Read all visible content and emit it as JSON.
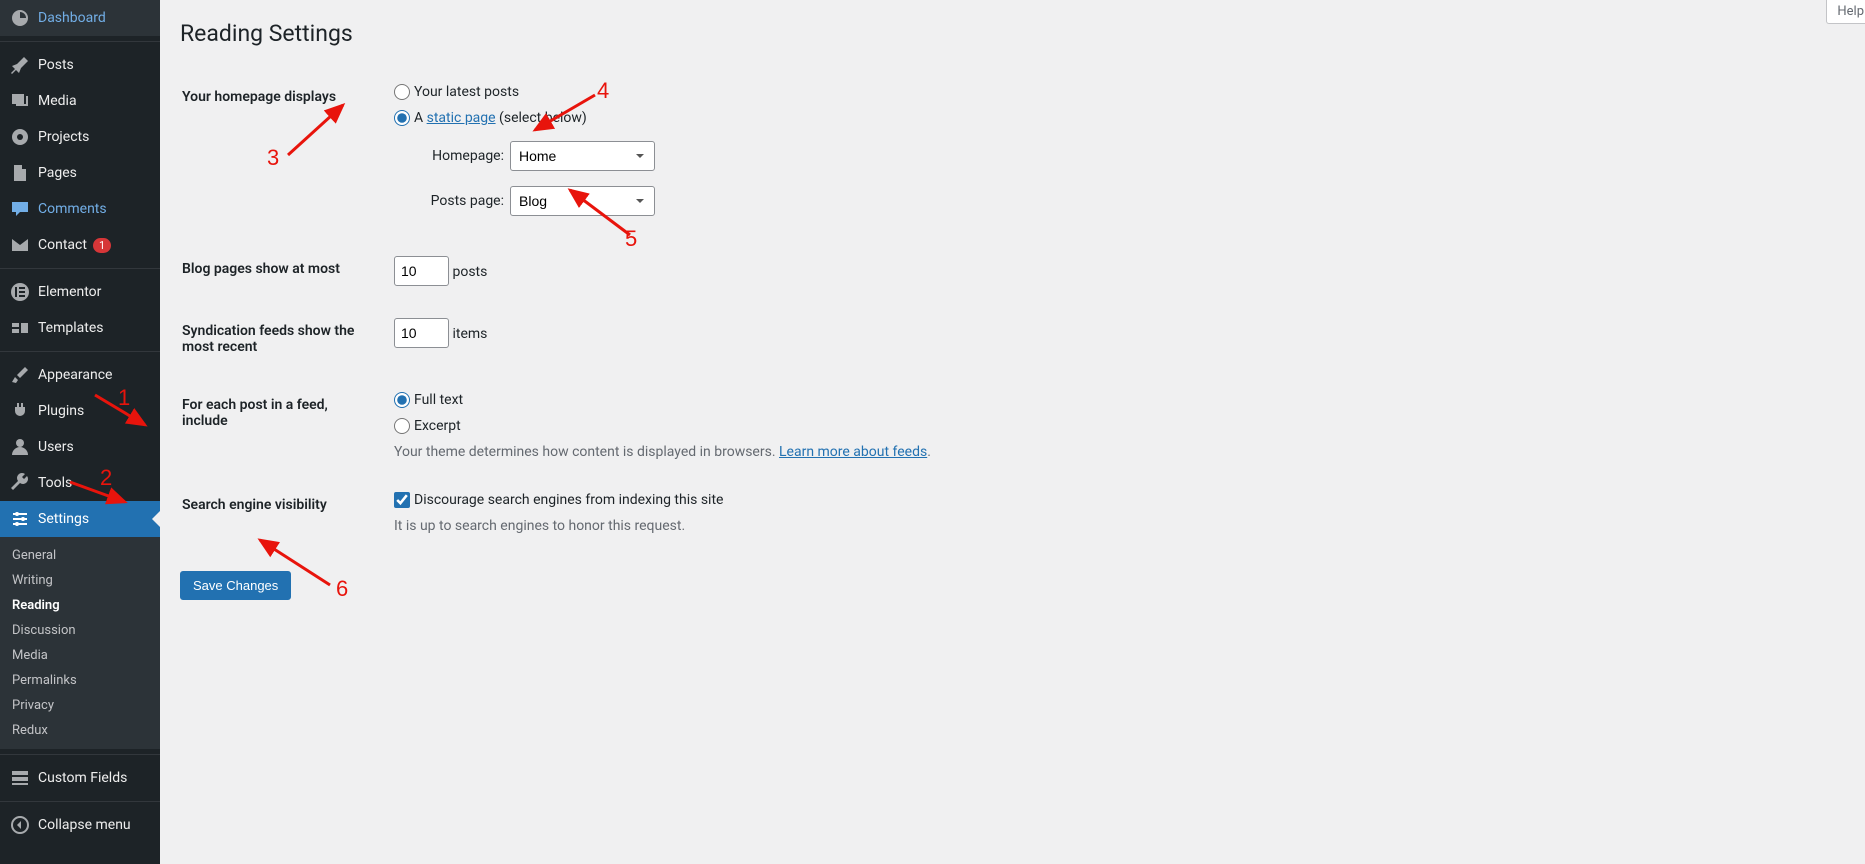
{
  "sidebar": {
    "items": [
      {
        "label": "Dashboard"
      },
      {
        "label": "Posts"
      },
      {
        "label": "Media"
      },
      {
        "label": "Projects"
      },
      {
        "label": "Pages"
      },
      {
        "label": "Comments"
      },
      {
        "label": "Contact",
        "badge": "1"
      },
      {
        "label": "Elementor"
      },
      {
        "label": "Templates"
      },
      {
        "label": "Appearance"
      },
      {
        "label": "Plugins"
      },
      {
        "label": "Users"
      },
      {
        "label": "Tools"
      },
      {
        "label": "Settings"
      },
      {
        "label": "Custom Fields"
      },
      {
        "label": "Collapse menu"
      }
    ],
    "submenu": [
      {
        "label": "General"
      },
      {
        "label": "Writing"
      },
      {
        "label": "Reading"
      },
      {
        "label": "Discussion"
      },
      {
        "label": "Media"
      },
      {
        "label": "Permalinks"
      },
      {
        "label": "Privacy"
      },
      {
        "label": "Redux"
      }
    ]
  },
  "page": {
    "title": "Reading Settings",
    "help_tab": "Help"
  },
  "form": {
    "homepage_displays": {
      "label": "Your homepage displays",
      "option_latest": "Your latest posts",
      "option_static_prefix": "A ",
      "option_static_link": "static page",
      "option_static_suffix": " (select below)",
      "homepage_label": "Homepage:",
      "homepage_value": "Home",
      "posts_page_label": "Posts page:",
      "posts_page_value": "Blog"
    },
    "blog_pages": {
      "label": "Blog pages show at most",
      "value": "10",
      "suffix": "posts"
    },
    "syndication": {
      "label": "Syndication feeds show the most recent",
      "value": "10",
      "suffix": "items"
    },
    "feed_include": {
      "label": "For each post in a feed, include",
      "option_full": "Full text",
      "option_excerpt": "Excerpt",
      "description_prefix": "Your theme determines how content is displayed in browsers. ",
      "description_link": "Learn more about feeds",
      "description_suffix": "."
    },
    "search_visibility": {
      "label": "Search engine visibility",
      "checkbox_label": "Discourage search engines from indexing this site",
      "description": "It is up to search engines to honor this request."
    },
    "save_button": "Save Changes"
  },
  "annotations": {
    "n1": "1",
    "n2": "2",
    "n3": "3",
    "n4": "4",
    "n5": "5",
    "n6": "6"
  }
}
